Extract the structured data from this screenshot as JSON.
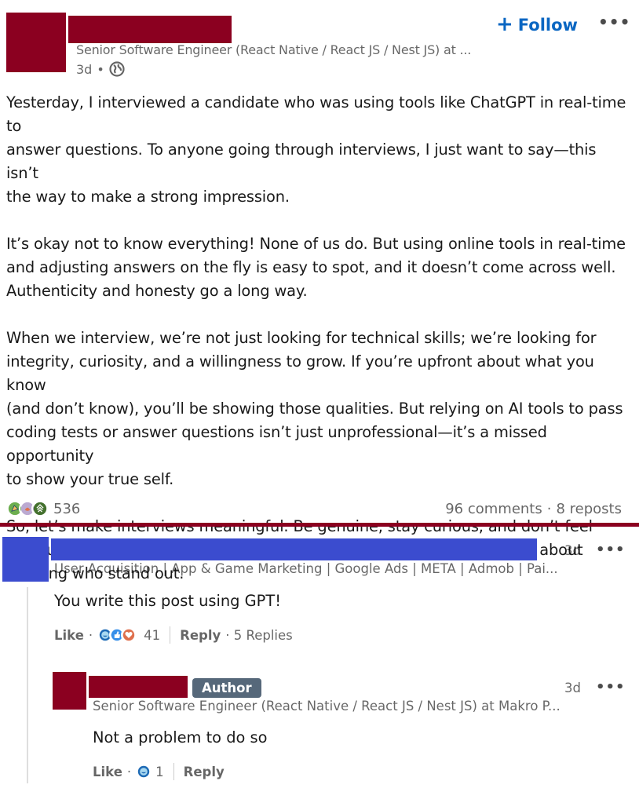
{
  "post": {
    "author_headline": "Senior Software Engineer (React Native / React JS / Nest JS) at ...",
    "time": "3d",
    "meta_sep": "•",
    "follow_label": "Follow",
    "follow_plus": "+",
    "more_label": "•••",
    "paragraphs": [
      "Yesterday, I interviewed a candidate who was using tools like ChatGPT in real-time to\nanswer questions. To anyone going through interviews, I just want to say—this isn’t\nthe way to make a strong impression.",
      "It’s okay not to know everything! None of us do. But using online tools in real-time\nand adjusting answers on the fly is easy to spot, and it doesn’t come across well.\nAuthenticity and honesty go a long way.",
      "When we interview, we’re not just looking for technical skills; we’re looking for\nintegrity, curiosity, and a willingness to grow. If you’re upfront about what you know\n(and don’t know), you’ll be showing those qualities. But relying on AI tools to pass\ncoding tests or answer questions isn’t just unprofessional—it’s a missed opportunity\nto show your true self.",
      "So, let’s make interviews meaningful. Be genuine, stay curious, and don’t feel\npressured to have all the answers. It’s those who are honest and open about\nlearning who stand out."
    ],
    "reaction_count": "536",
    "comments_count": "96 comments",
    "social_sep": "·",
    "reposts_count": "8 reposts",
    "reaction_icons": [
      "celebrate-icon",
      "support-icon",
      "insightful-icon"
    ]
  },
  "comments": [
    {
      "headline": "User Acquisition | App & Game Marketing | Google Ads | META | Admob | Pai...",
      "time": "3d",
      "more": "•••",
      "text": "You write this post using GPT!",
      "like_label": "Like",
      "dot": "·",
      "reaction_count": "41",
      "reply_label": "Reply",
      "replies_label": "· 5 Replies"
    },
    {
      "badge": "Author",
      "headline": "Senior Software Engineer (React Native / React JS / Nest JS) at Makro P...",
      "time": "3d",
      "more": "•••",
      "text": "Not a problem to do so",
      "like_label": "Like",
      "dot": "·",
      "reaction_count": "1",
      "reply_label": "Reply"
    }
  ],
  "colors": {
    "redaction_red": "#8b0020",
    "redaction_blue": "#3b4ccf",
    "link_blue": "#0a66c2",
    "author_badge": "#56687a"
  }
}
